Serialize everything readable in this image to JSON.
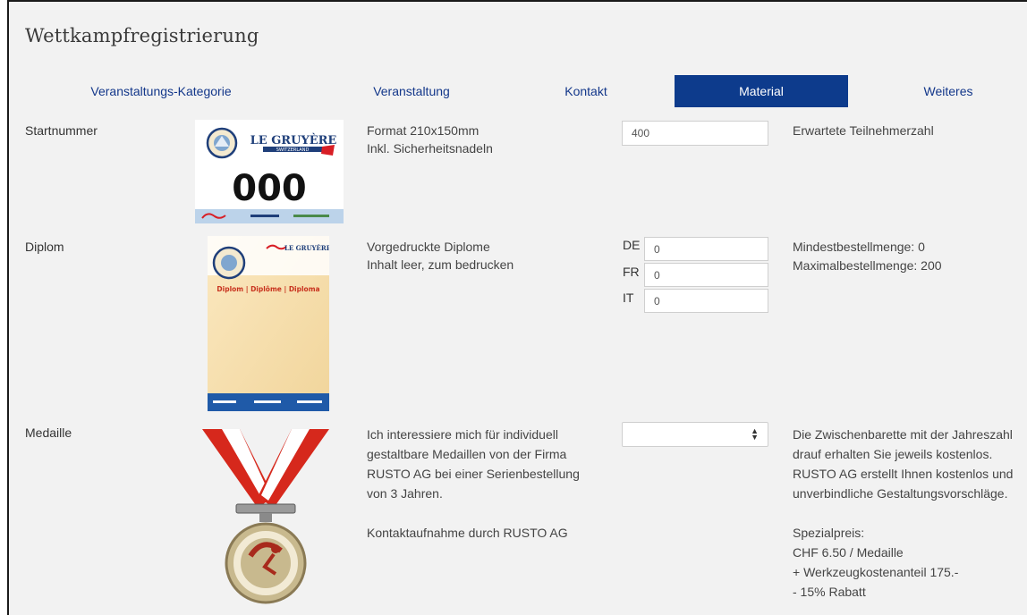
{
  "page": {
    "title": "Wettkampfregistrierung"
  },
  "tabs": [
    {
      "label": "Veranstaltungs-Kategorie",
      "active": false
    },
    {
      "label": "Veranstaltung",
      "active": false
    },
    {
      "label": "Kontakt",
      "active": false
    },
    {
      "label": "Material",
      "active": true
    },
    {
      "label": "Weiteres",
      "active": false
    }
  ],
  "colors": {
    "accent": "#0d3b8c",
    "tab_text": "#13378a",
    "background": "#f2f2f2"
  },
  "startnummer": {
    "label": "Startnummer",
    "image": {
      "brand": "LE GRUYÈRE",
      "brand_sub": "SWITZERLAND",
      "number": "000"
    },
    "desc": [
      "Format 210x150mm",
      "Inkl. Sicherheitsnadeln"
    ],
    "input_value": "400",
    "info": "Erwartete Teilnehmerzahl"
  },
  "diplom": {
    "label": "Diplom",
    "image": {
      "brand": "LE GRUYÈRE",
      "heading": "Diplom | Diplôme | Diploma"
    },
    "desc": [
      "Vorgedruckte Diplome",
      "Inhalt leer, zum bedrucken"
    ],
    "languages": [
      {
        "code": "DE",
        "value": "0"
      },
      {
        "code": "FR",
        "value": "0"
      },
      {
        "code": "IT",
        "value": "0"
      }
    ],
    "info": [
      "Mindestbestellmenge: 0",
      "Maximalbestellmenge: 200"
    ]
  },
  "medaille": {
    "label": "Medaille",
    "desc": [
      "Ich interessiere mich für individuell",
      "gestaltbare Medaillen von der Firma",
      "RUSTO AG bei einer Serienbestellung",
      "von 3 Jahren.",
      "",
      "Kontaktaufnahme durch RUSTO AG"
    ],
    "select_value": "",
    "info": [
      "Die Zwischenbarette mit der Jahreszahl",
      "drauf erhalten Sie jeweils kostenlos.",
      "RUSTO AG erstellt Ihnen kostenlos und",
      "unverbindliche Gestaltungsvorschläge.",
      "",
      "Spezialpreis:",
      "CHF 6.50 / Medaille",
      "+ Werkzeugkostenanteil 175.-",
      "- 15% Rabatt"
    ]
  },
  "icons": {
    "select_arrows": "sort-arrows-icon"
  }
}
